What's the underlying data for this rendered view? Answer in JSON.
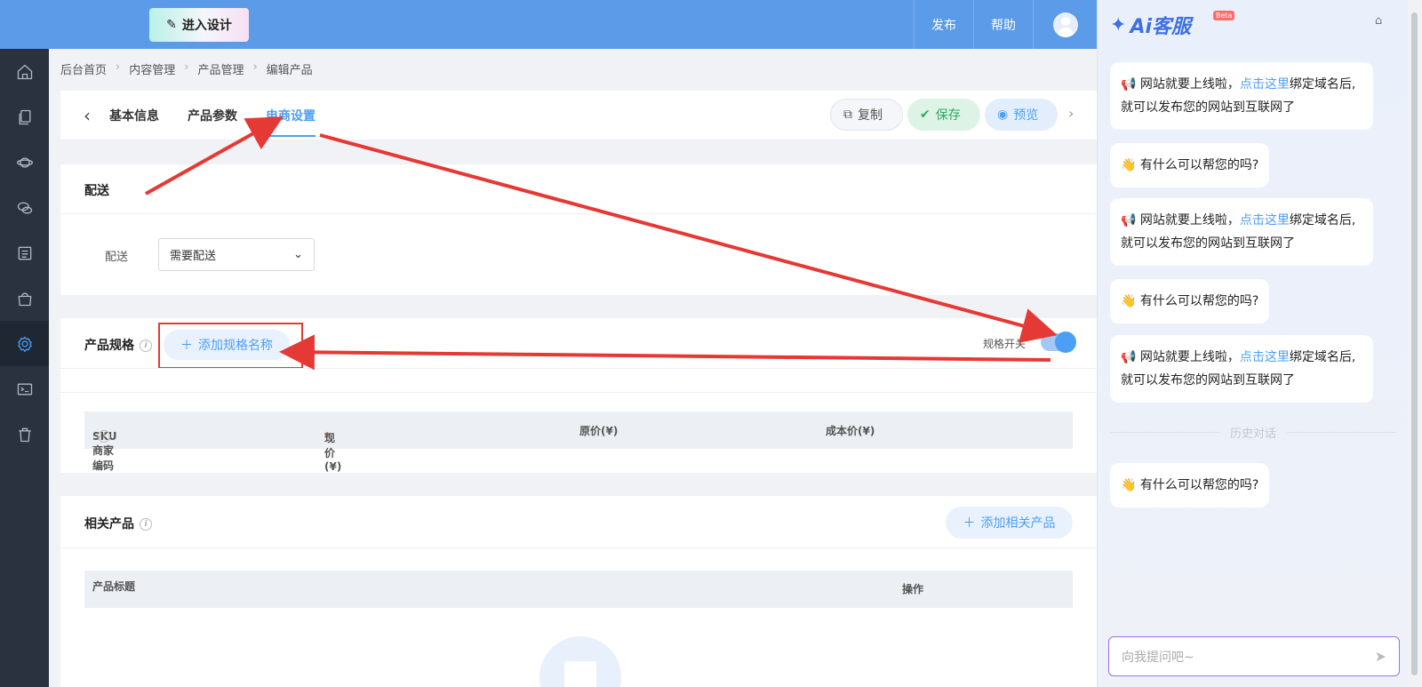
{
  "topbar": {
    "enter_design": "进入设计",
    "publish": "发布",
    "help": "帮助"
  },
  "sidebar": {
    "items": [
      "home-icon",
      "pages-icon",
      "planet-icon",
      "chat-icon",
      "list-icon",
      "shop-icon",
      "settings-icon",
      "terminal-icon",
      "trash-icon"
    ],
    "active_index": 6
  },
  "breadcrumb": [
    "后台首页",
    "内容管理",
    "产品管理",
    "编辑产品"
  ],
  "tabs": [
    "基本信息",
    "产品参数",
    "电商设置"
  ],
  "active_tab": "电商设置",
  "actions": {
    "copy": "复制",
    "save": "保存",
    "preview": "预览"
  },
  "shipping": {
    "title": "配送",
    "field_label": "配送",
    "selected": "需要配送"
  },
  "spec": {
    "title": "产品规格",
    "add_button": "添加规格名称",
    "switch_label": "规格开关",
    "switch_on": true,
    "columns": [
      "SKU商家编码",
      "现价(¥)",
      "原价(¥)",
      "成本价(¥)"
    ]
  },
  "related": {
    "title": "相关产品",
    "add_button": "添加相关产品",
    "columns": [
      "产品标题",
      "操作"
    ]
  },
  "chat": {
    "brand": "Ai客服",
    "beta": "Beta",
    "messages": [
      {
        "pre": "网站就要上线啦，",
        "link": "点击这里",
        "post": "绑定域名后,就可以发布您的网站到互联网了"
      },
      {
        "text": "有什么可以帮您的吗?"
      },
      {
        "pre": "网站就要上线啦，",
        "link": "点击这里",
        "post": "绑定域名后,就可以发布您的网站到互联网了"
      },
      {
        "text": "有什么可以帮您的吗?"
      },
      {
        "pre": "网站就要上线啦，",
        "link": "点击这里",
        "post": "绑定域名后,就可以发布您的网站到互联网了"
      },
      {
        "text": "有什么可以帮您的吗?"
      }
    ],
    "history_label": "历史对话",
    "input_placeholder": "向我提问吧~"
  },
  "colors": {
    "accent": "#4c9ff4",
    "topbar": "#5b9be8",
    "sidebar": "#2a3240",
    "annotation": "#e53935"
  }
}
